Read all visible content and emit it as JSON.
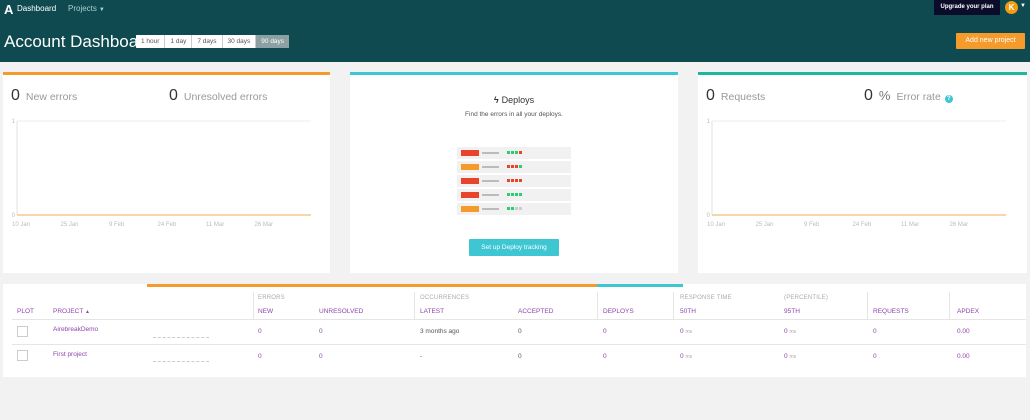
{
  "nav": {
    "logo_glyph": "A",
    "dashboard": "Dashboard",
    "projects": "Projects",
    "upgrade": "Upgrade your plan",
    "avatar_initial": "K",
    "colors": {
      "nav_bg": "#0f4a50",
      "accent_orange": "#f59b2c",
      "accent_cyan": "#3ec6d3",
      "accent_teal": "#1fb5a0",
      "link_purple": "#8e44ad"
    }
  },
  "header": {
    "title": "Account Dashboard",
    "ranges": [
      {
        "label": "1 hour",
        "active": false
      },
      {
        "label": "1 day",
        "active": false
      },
      {
        "label": "7 days",
        "active": false
      },
      {
        "label": "30 days",
        "active": false
      },
      {
        "label": "90 days",
        "active": true
      }
    ],
    "add_project": "Add new project"
  },
  "errors_card": {
    "new_errors_count": "0",
    "new_errors_label": "New errors",
    "unresolved_count": "0",
    "unresolved_label": "Unresolved errors"
  },
  "deploys_card": {
    "icon": "bolt-icon",
    "title": "Deploys",
    "subtitle": "Find the errors in all your deploys.",
    "button": "Set up Deploy tracking",
    "rows": [
      {
        "bar": "#e8442c",
        "dots": [
          "#2ecc71",
          "#2ecc71",
          "#2ecc71",
          "#e8442c"
        ]
      },
      {
        "bar": "#f59b2c",
        "dots": [
          "#e8442c",
          "#e8442c",
          "#e8442c",
          "#2ecc71"
        ]
      },
      {
        "bar": "#e8442c",
        "dots": [
          "#e8442c",
          "#e8442c",
          "#e8442c",
          "#e8442c"
        ]
      },
      {
        "bar": "#e8442c",
        "dots": [
          "#2ecc71",
          "#2ecc71",
          "#2ecc71",
          "#2ecc71"
        ]
      },
      {
        "bar": "#f59b2c",
        "dots": [
          "#2ecc71",
          "#2ecc71",
          "#cccccc",
          "#cccccc"
        ]
      }
    ]
  },
  "perf_card": {
    "requests_count": "0",
    "requests_label": "Requests",
    "error_rate_count": "0",
    "error_rate_unit": "%",
    "error_rate_label": "Error rate",
    "info_icon": "?"
  },
  "chart_data": [
    {
      "type": "line",
      "x": [
        "10 Jan",
        "25 Jan",
        "9 Feb",
        "24 Feb",
        "11 Mar",
        "26 Mar"
      ],
      "series": [
        {
          "values": [
            0,
            0,
            0,
            0,
            0,
            0
          ]
        }
      ],
      "ylim": [
        0,
        1
      ],
      "yticks": [
        "0",
        "1"
      ],
      "grid": true
    },
    {
      "type": "line",
      "x": [
        "10 Jan",
        "25 Jan",
        "9 Feb",
        "24 Feb",
        "11 Mar",
        "26 Mar"
      ],
      "series": [
        {
          "values": [
            0,
            0,
            0,
            0,
            0,
            0
          ]
        }
      ],
      "ylim": [
        0,
        1
      ],
      "yticks": [
        "0",
        "1"
      ],
      "grid": true
    }
  ],
  "table": {
    "groups": {
      "errors": "ERRORS",
      "occurrences": "OCCURRENCES",
      "response_time": "RESPONSE TIME",
      "percentile": "(PERCENTILE)"
    },
    "headers": {
      "plot": "PLOT",
      "project": "PROJECT",
      "new": "NEW",
      "unresolved": "UNRESOLVED",
      "latest": "LATEST",
      "accepted": "ACCEPTED",
      "deploys": "DEPLOYS",
      "p50": "50TH",
      "p95": "95TH",
      "requests": "REQUESTS",
      "apdex": "APDEX"
    },
    "sort_icon": "▲",
    "ms_unit": "ms",
    "rows": [
      {
        "project": "AirebreakDemo",
        "new": "0",
        "unresolved": "0",
        "latest": "3 months ago",
        "accepted": "0",
        "deploys": "0",
        "p50": "0",
        "p95": "0",
        "requests": "0",
        "apdex": "0.00"
      },
      {
        "project": "First project",
        "new": "0",
        "unresolved": "0",
        "latest": "-",
        "accepted": "0",
        "deploys": "0",
        "p50": "0",
        "p95": "0",
        "requests": "0",
        "apdex": "0.00"
      }
    ]
  }
}
